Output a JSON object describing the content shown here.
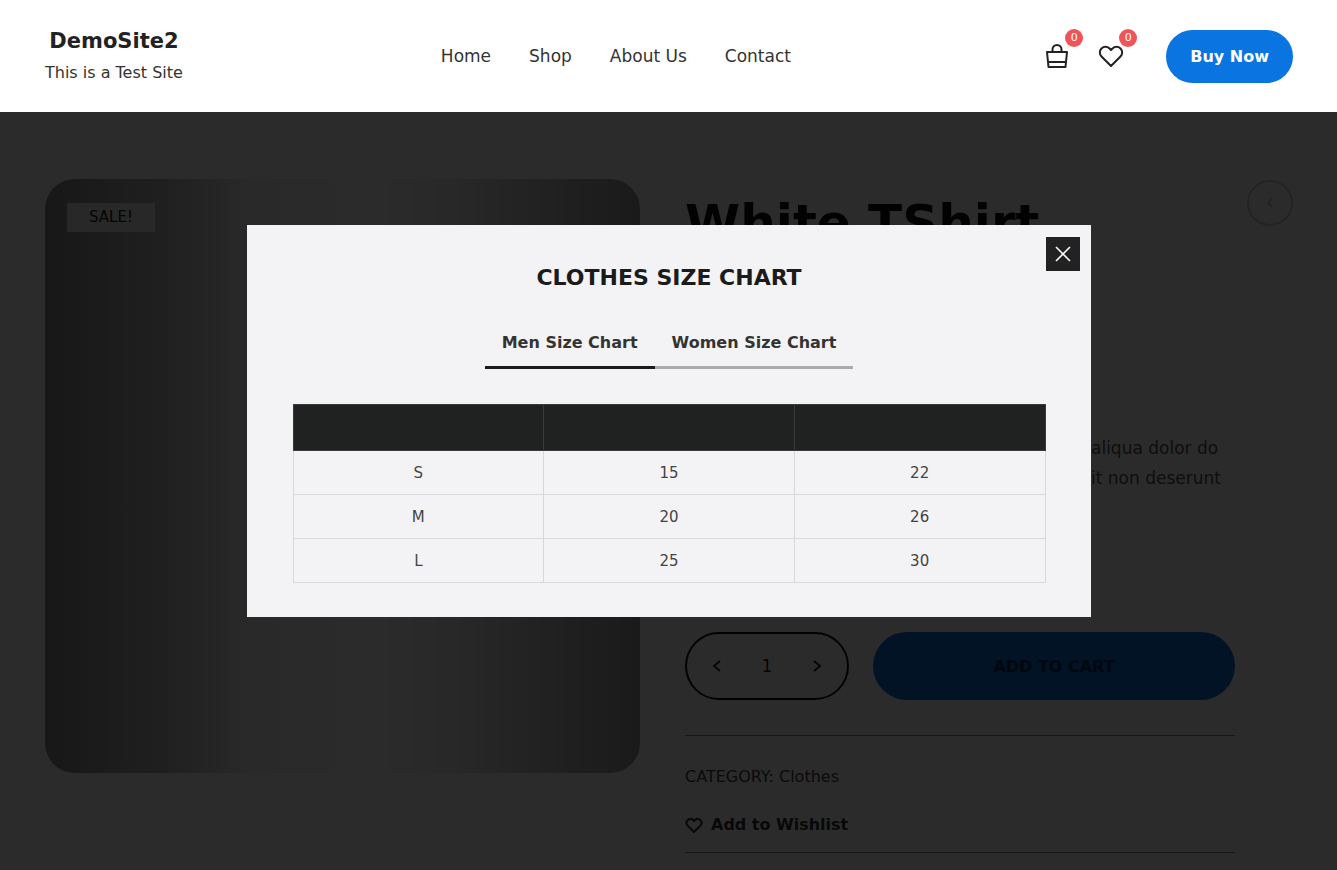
{
  "header": {
    "logo": {
      "title": "DemoSite2",
      "tagline": "This is a Test Site"
    },
    "nav": [
      {
        "label": "Home"
      },
      {
        "label": "Shop"
      },
      {
        "label": "About Us"
      },
      {
        "label": "Contact"
      }
    ],
    "cart_count": "0",
    "wishlist_count": "0",
    "buy_button": "Buy Now"
  },
  "product": {
    "badge": "SALE!",
    "title": "White TShirt",
    "description_lines": [
      "aliqua dolor do",
      "it non deserunt"
    ],
    "quantity": "1",
    "add_to_cart": "ADD TO CART",
    "category": "CATEGORY: Clothes",
    "wishlist": "Add to Wishlist"
  },
  "modal": {
    "title": "CLOTHES SIZE CHART",
    "tabs": [
      {
        "label": "Men Size Chart",
        "selected": true
      },
      {
        "label": "Women Size Chart",
        "selected": false
      }
    ],
    "table": {
      "rows": [
        [
          "S",
          "15",
          "22"
        ],
        [
          "M",
          "20",
          "26"
        ],
        [
          "L",
          "25",
          "30"
        ]
      ]
    }
  }
}
